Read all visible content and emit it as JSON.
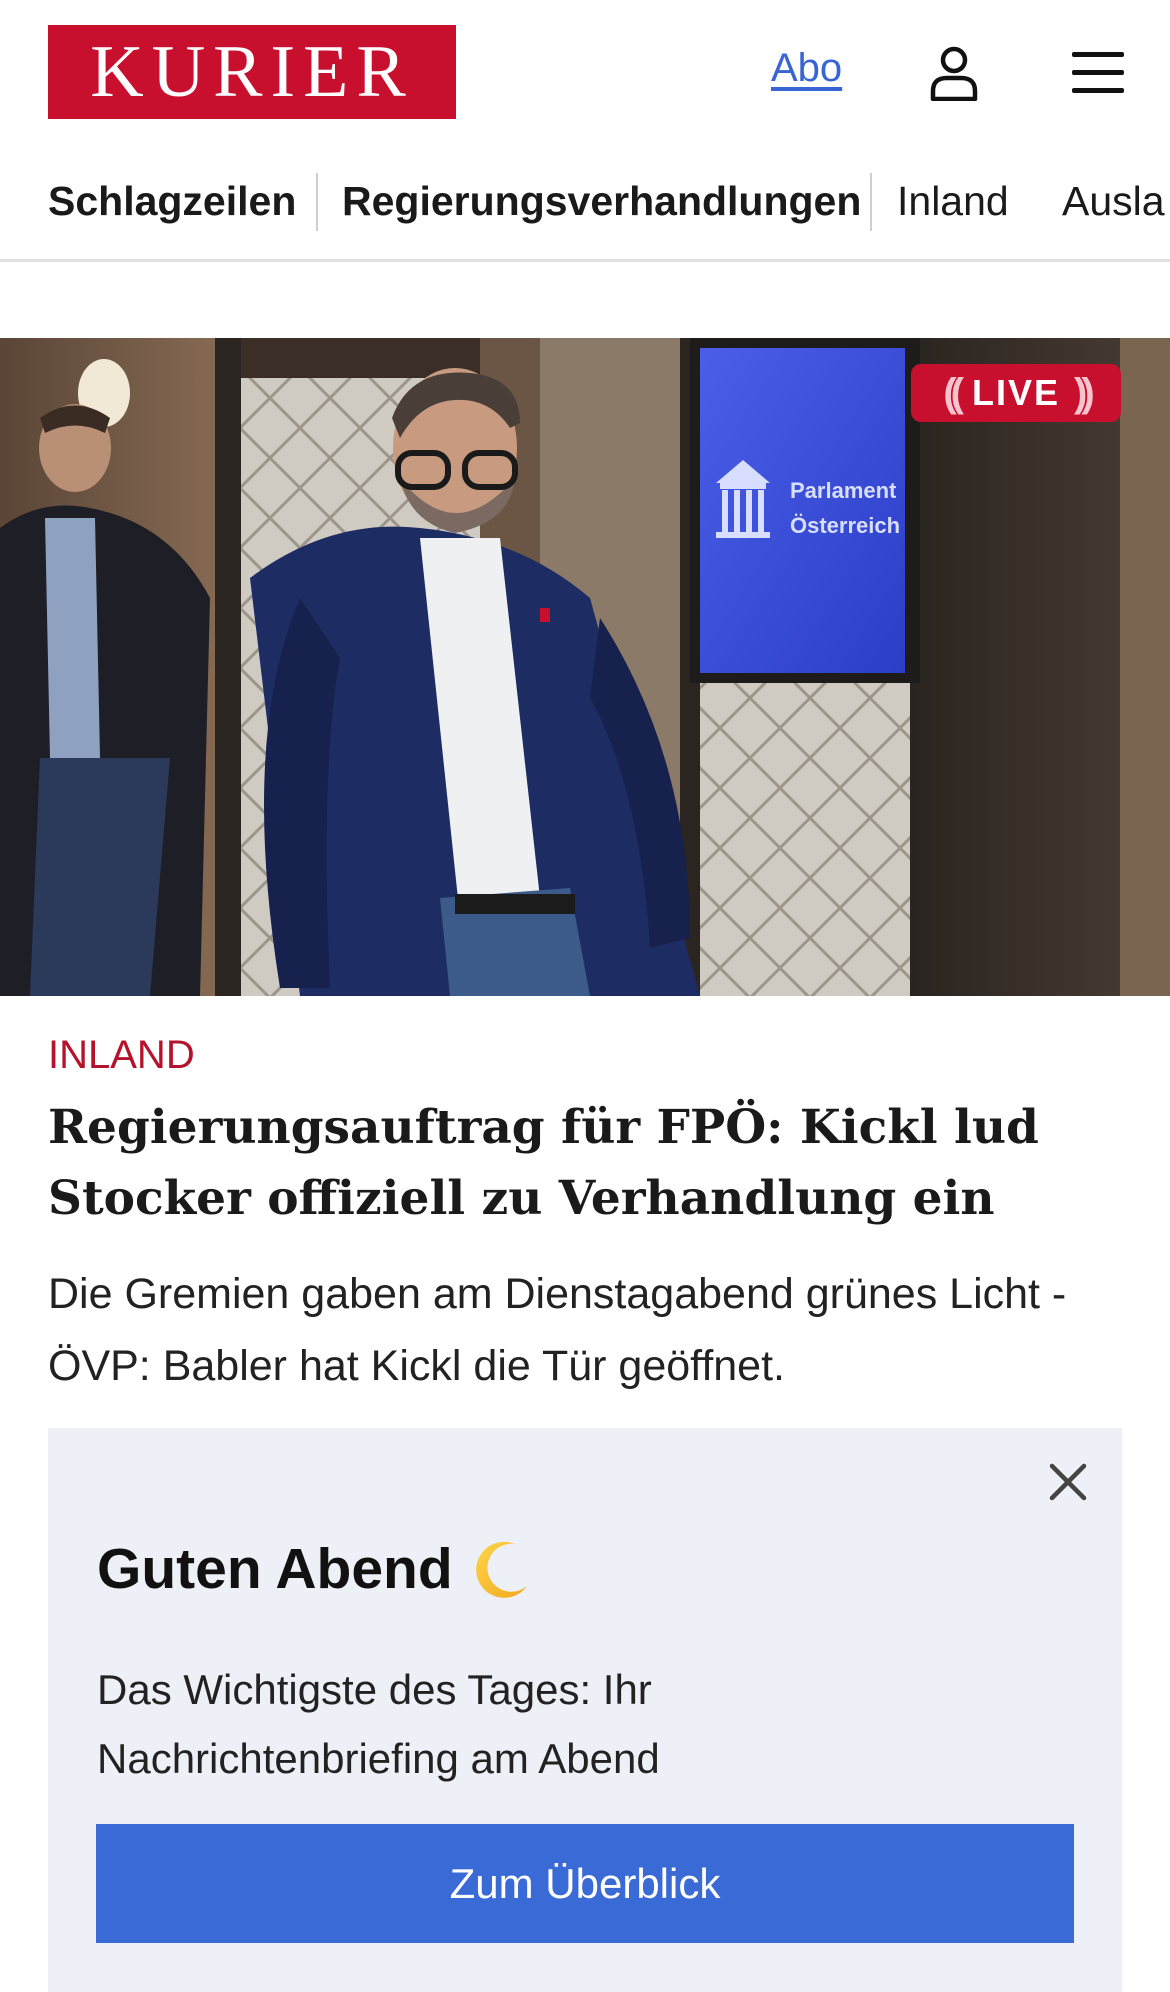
{
  "header": {
    "logo_text": "KURIER",
    "abo_label": "Abo",
    "user_icon": "user-icon",
    "menu_icon": "hamburger-menu-icon"
  },
  "nav": {
    "items": [
      {
        "label": "Schlagzeilen"
      },
      {
        "label": "Regierungsverhandlungen"
      },
      {
        "label": "Inland"
      },
      {
        "label": "Ausla"
      }
    ]
  },
  "hero": {
    "live_label": "LIVE",
    "sign_line1": "Parlament",
    "sign_line2": "Österreich"
  },
  "article": {
    "section": "INLAND",
    "headline": "Regierungsauftrag für FPÖ: Kickl lud Sto­cker offiziell zu Verhandlung ein",
    "teaser": "Die Gremien gaben am Dienstagabend grünes Licht - ÖVP: Babler hat Kickl die Tür geöffnet."
  },
  "briefing": {
    "title": "Guten Abend",
    "icon": "crescent-moon-icon",
    "text": "Das Wichtigste des Tages: Ihr Nachrichtenbriefing am Abend",
    "button_label": "Zum Überblick",
    "close_icon": "close-icon"
  },
  "colors": {
    "brand_red": "#c8102e",
    "link_blue": "#3864d6",
    "button_blue": "#3a6ad6",
    "briefing_bg": "#eef0f7"
  }
}
